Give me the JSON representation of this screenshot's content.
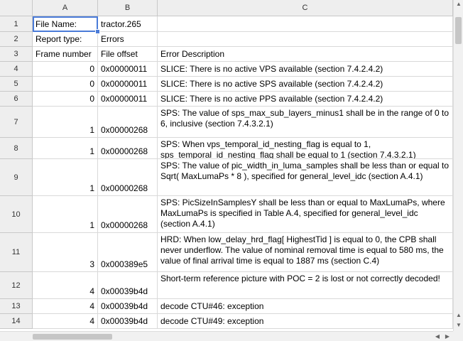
{
  "columns": [
    "A",
    "B",
    "C"
  ],
  "rows": [
    {
      "num": "1",
      "a": "File Name:",
      "b": "tractor.265",
      "c": ""
    },
    {
      "num": "2",
      "a": "Report type:",
      "b": "Errors",
      "c": ""
    },
    {
      "num": "3",
      "a": "Frame number",
      "b": "File offset",
      "c": "Error Description"
    },
    {
      "num": "4",
      "a": "0",
      "b": "0x00000011",
      "c": "SLICE: There is no active VPS available (section 7.4.2.4.2)"
    },
    {
      "num": "5",
      "a": "0",
      "b": "0x00000011",
      "c": "SLICE: There is no active SPS available (section 7.4.2.4.2)"
    },
    {
      "num": "6",
      "a": "0",
      "b": "0x00000011",
      "c": "SLICE: There is no active PPS available (section 7.4.2.4.2)"
    },
    {
      "num": "7",
      "a": "1",
      "b": "0x00000268",
      "c": "SPS: The value of sps_max_sub_layers_minus1 shall be in the range of 0 to 6, inclusive (section 7.4.3.2.1)"
    },
    {
      "num": "8",
      "a": "1",
      "b": "0x00000268",
      "c": "SPS: When vps_temporal_id_nesting_flag is equal to 1, sps_temporal_id_nesting_flag shall be equal to 1 (section 7.4.3.2.1)"
    },
    {
      "num": "9",
      "a": "1",
      "b": "0x00000268",
      "c": "SPS: The value of pic_width_in_luma_samples shall be less than or equal to Sqrt( MaxLumaPs * 8 ), specified for general_level_idc (section A.4.1)"
    },
    {
      "num": "10",
      "a": "1",
      "b": "0x00000268",
      "c": "SPS: PicSizeInSamplesY shall be less than or equal to MaxLumaPs, where MaxLumaPs is specified in Table A.4, specified for general_level_idc (section A.4.1)"
    },
    {
      "num": "11",
      "a": "3",
      "b": "0x000389e5",
      "c": "HRD: When low_delay_hrd_flag[ HighestTid ] is equal to 0, the CPB shall never underflow. The value of nominal removal time is equal to 580 ms, the value of final arrival time is equal to 1887 ms (section C.4)"
    },
    {
      "num": "12",
      "a": "4",
      "b": "0x00039b4d",
      "c": "Short-term reference picture with POC = 2 is lost or not correctly decoded!"
    },
    {
      "num": "13",
      "a": "4",
      "b": "0x00039b4d",
      "c": "decode CTU#46: exception"
    },
    {
      "num": "14",
      "a": "4",
      "b": "0x00039b4d",
      "c": "decode CTU#49: exception"
    }
  ]
}
